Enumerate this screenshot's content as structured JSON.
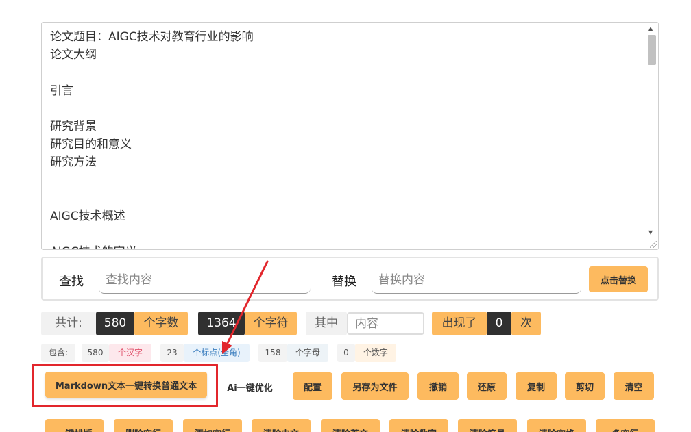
{
  "editor": {
    "lines": [
      "论文题目：AIGC技术对教育行业的影响",
      "论文大纲",
      "",
      "引言",
      "",
      "研究背景",
      "研究目的和意义",
      "研究方法",
      "",
      "",
      "AIGC技术概述",
      "",
      "AIGC技术的定义"
    ]
  },
  "find": {
    "find_label": "查找",
    "find_placeholder": "查找内容",
    "replace_label": "替换",
    "replace_placeholder": "替换内容",
    "replace_button": "点击替换"
  },
  "stats": {
    "total_label": "共计:",
    "char_count": "580",
    "char_unit": "个字数",
    "symbol_count": "1364",
    "symbol_unit": "个字符",
    "among_label": "其中",
    "match_placeholder": "内容",
    "appeared_label": "出现了",
    "appeared_count": "0",
    "times_unit": "次"
  },
  "tags": {
    "include_label": "包含:",
    "hanzi_count": "580",
    "hanzi_unit": "个汉字",
    "punct_count": "23",
    "punct_unit": "个标点(全角)",
    "letter_count": "158",
    "letter_unit": "个字母",
    "digit_count": "0",
    "digit_unit": "个数字"
  },
  "actions": {
    "markdown": "Markdown文本一键转换普通文本",
    "ai_optimize": "Ai一键优化",
    "config": "配置",
    "save_as": "另存为文件",
    "undo": "撤销",
    "redo": "还原",
    "copy": "复制",
    "cut": "剪切",
    "clear": "清空"
  },
  "more_actions": {
    "one_click_format": "一键排版",
    "remove_blank_lines": "删除空行",
    "add_blank_lines": "添加空行",
    "clear_chinese": "清除中文",
    "clear_english": "清除英文",
    "clear_digits": "清除数字",
    "clear_symbols": "清除符号",
    "clear_spaces": "清除空格",
    "more": "多空行"
  },
  "colors": {
    "accent": "#fdba5f",
    "dark": "#303030",
    "highlight": "#e2262c"
  }
}
